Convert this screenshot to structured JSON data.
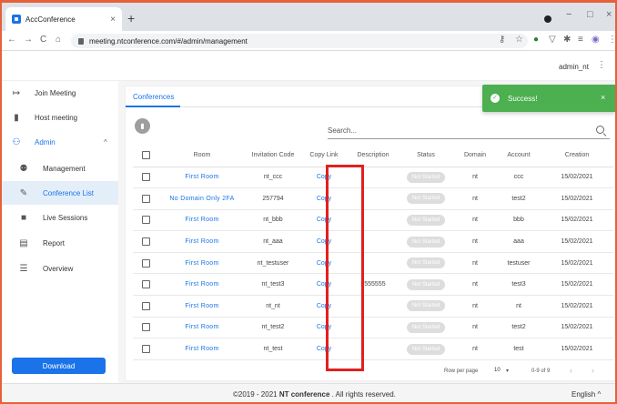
{
  "browser": {
    "tab_title": "AccConference",
    "tab_close": "×",
    "new_tab": "+",
    "url": "meeting.ntconference.com/#/admin/management",
    "nav_back": "←",
    "nav_forward": "→",
    "nav_reload": "C",
    "nav_home": "⌂",
    "win_minimize": "−",
    "win_maximize": "□",
    "win_close": "×"
  },
  "header": {
    "user": "admin_nt",
    "menu_icon": "⋮"
  },
  "sidebar": {
    "items": [
      {
        "label": "Join Meeting",
        "icon": "↦"
      },
      {
        "label": "Host meeting",
        "icon": "▮"
      },
      {
        "label": "Admin",
        "icon": "⚇",
        "chevron": "^"
      },
      {
        "label": "Management",
        "icon": "⚉"
      },
      {
        "label": "Conference List",
        "icon": "✎"
      },
      {
        "label": "Live Sessions",
        "icon": "■"
      },
      {
        "label": "Report",
        "icon": "▤"
      },
      {
        "label": "Overview",
        "icon": "☰"
      }
    ],
    "download": "Download"
  },
  "main": {
    "tab": "Conferences",
    "search_placeholder": "Search...",
    "trash_icon": "▮",
    "columns": [
      "Room",
      "Invitation Code",
      "Copy Link",
      "Description",
      "Status",
      "Domain",
      "Account",
      "Creation"
    ],
    "rows": [
      {
        "room": "First Room",
        "code": "nt_ccc",
        "copy": "Copy",
        "description": "",
        "status": "Not Started",
        "domain": "nt",
        "account": "ccc",
        "creation": "15/02/2021"
      },
      {
        "room": "No Domain Only 2FA",
        "code": "257794",
        "copy": "Copy",
        "description": "",
        "status": "Not Started",
        "domain": "nt",
        "account": "test2",
        "creation": "15/02/2021"
      },
      {
        "room": "First Room",
        "code": "nt_bbb",
        "copy": "Copy",
        "description": "",
        "status": "Not Started",
        "domain": "nt",
        "account": "bbb",
        "creation": "15/02/2021"
      },
      {
        "room": "First Room",
        "code": "nt_aaa",
        "copy": "Copy",
        "description": "",
        "status": "Not Started",
        "domain": "nt",
        "account": "aaa",
        "creation": "15/02/2021"
      },
      {
        "room": "First Room",
        "code": "nt_testuser",
        "copy": "Copy",
        "description": "",
        "status": "Not Started",
        "domain": "nt",
        "account": "testuser",
        "creation": "15/02/2021"
      },
      {
        "room": "First Room",
        "code": "nt_test3",
        "copy": "Copy",
        "description": "5555555",
        "status": "Not Started",
        "domain": "nt",
        "account": "test3",
        "creation": "15/02/2021"
      },
      {
        "room": "First Room",
        "code": "nt_nt",
        "copy": "Copy",
        "description": "",
        "status": "Not Started",
        "domain": "nt",
        "account": "nt",
        "creation": "15/02/2021"
      },
      {
        "room": "First Room",
        "code": "nt_test2",
        "copy": "Copy",
        "description": "",
        "status": "Not Started",
        "domain": "nt",
        "account": "test2",
        "creation": "15/02/2021"
      },
      {
        "room": "First Room",
        "code": "nt_test",
        "copy": "Copy",
        "description": "",
        "status": "Not Started",
        "domain": "nt",
        "account": "test",
        "creation": "15/02/2021"
      }
    ],
    "pager": {
      "rows_per_page_label": "Row per page",
      "rows_per_page": "10",
      "range": "0-9 of 9",
      "prev": "‹",
      "next": "›"
    }
  },
  "toast": {
    "text": "Success!",
    "close": "×",
    "icon": "✓",
    "color": "#4caf50"
  },
  "footer": {
    "prefix": "©2019 - 2021 ",
    "brand": "NT conference",
    "suffix": " . All rights reserved.",
    "language": "English ^"
  },
  "colors": {
    "accent": "#1a73e8",
    "highlight": "#e02020",
    "frame": "#e6603a"
  }
}
